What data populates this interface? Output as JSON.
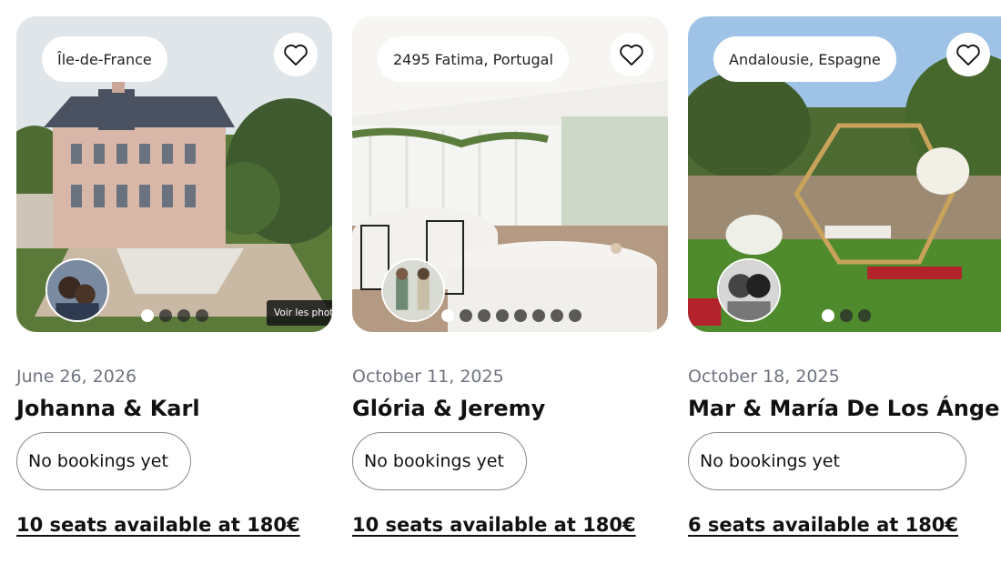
{
  "cards": [
    {
      "location": "Île-de-France",
      "date": "June 26, 2026",
      "names": "Johanna & Karl",
      "bookings": "No bookings yet",
      "seats": "10 seats available at 180€",
      "see_photos": "Voir les photos",
      "photo_dots": 4,
      "active_dot": 1
    },
    {
      "location": "2495 Fatima, Portugal",
      "date": "October 11, 2025",
      "names": "Glória & Jeremy",
      "bookings": "No bookings yet",
      "seats": "10 seats available at 180€",
      "photo_dots": 8,
      "active_dot": 1
    },
    {
      "location": "Andalousie, Espagne",
      "date": "October 18, 2025",
      "names": "Mar & María De Los Ángeles",
      "bookings": "No bookings yet",
      "seats": "6 seats available at 180€",
      "photo_dots": 3,
      "active_dot": 1
    }
  ],
  "icons": {
    "favorite": "heart-outline-icon"
  },
  "colors": {
    "date_text": "#6f7380",
    "pill_border": "#888888"
  }
}
